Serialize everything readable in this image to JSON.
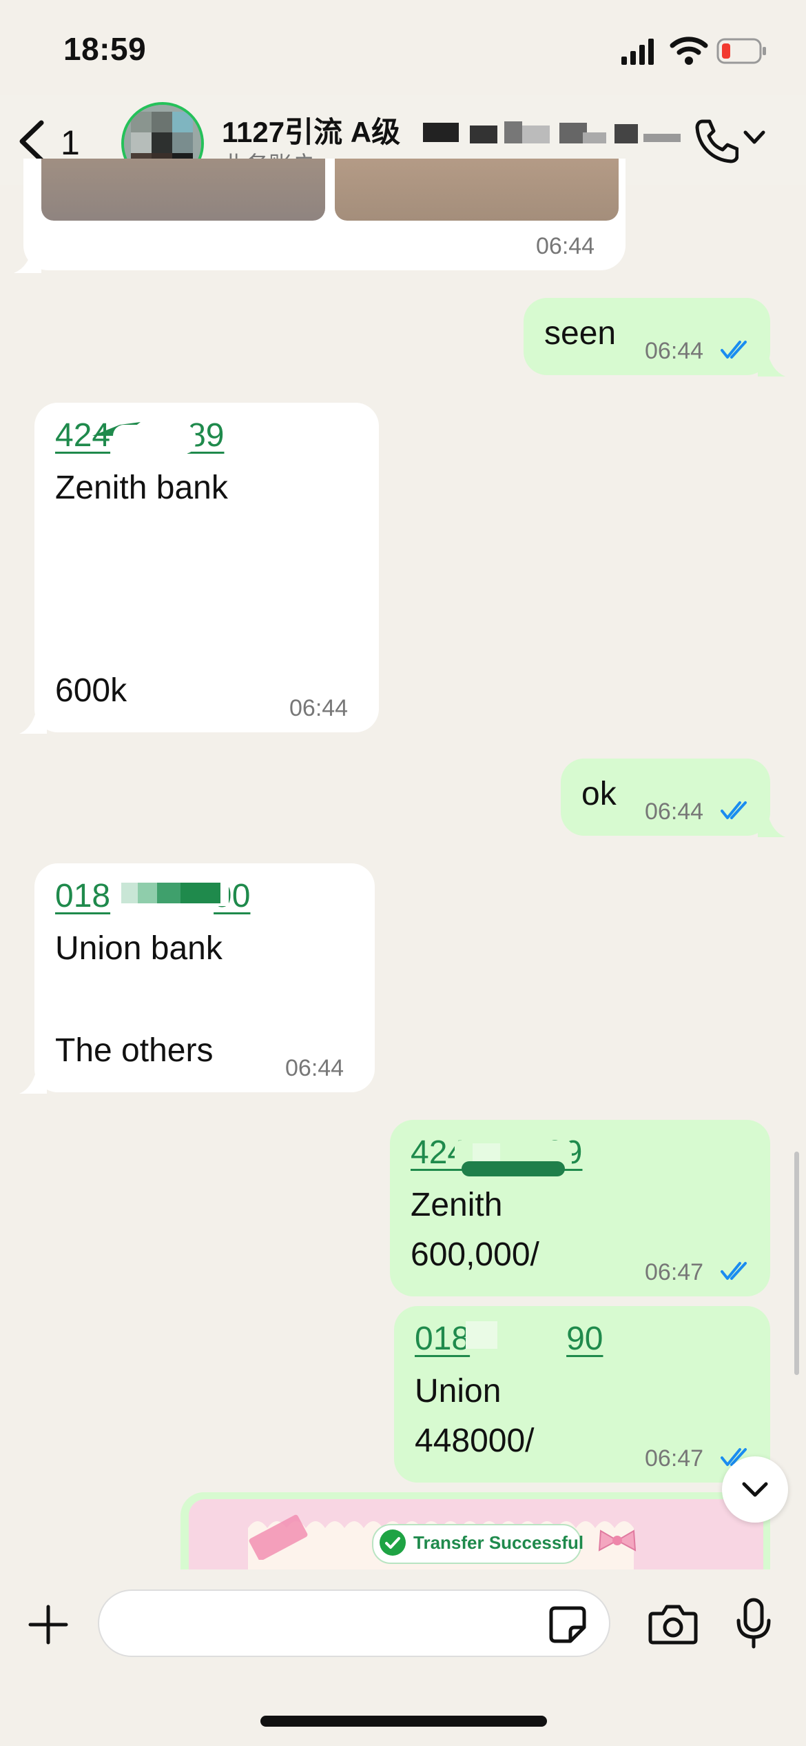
{
  "status_bar": {
    "time": "18:59"
  },
  "header": {
    "back_count": "1",
    "title": "1127引流 A级",
    "subtitle": "业务账户"
  },
  "messages": [
    {
      "time": "06:44"
    },
    {
      "text": "seen",
      "time": "06:44"
    },
    {
      "link": "424",
      "link_end": "89",
      "line1": "Zenith bank",
      "line2": "600k",
      "time": "06:44"
    },
    {
      "text": "ok",
      "time": "06:44"
    },
    {
      "link": "018",
      "link_end": "90",
      "line1": "Union bank",
      "line2": "The others",
      "time": "06:44"
    },
    {
      "link": "424",
      "link_end": "89",
      "line1": "Zenith",
      "line2": "600,000/",
      "time": "06:47"
    },
    {
      "link": "018",
      "link_end": "90",
      "line1": "Union",
      "line2": "448000/",
      "time": "06:47"
    },
    {
      "sticker_text": "Transfer Successful"
    }
  ],
  "composer": {
    "placeholder": ""
  },
  "icons": [
    "cellular-signal-icon",
    "wifi-icon",
    "battery-icon",
    "back-chevron-icon",
    "phone-icon",
    "chevron-down-icon",
    "double-check-icon",
    "plus-icon",
    "sticker-icon",
    "camera-icon",
    "microphone-icon",
    "scroll-down-icon"
  ],
  "colors": {
    "outgoing_bubble": "#d7fad0",
    "incoming_bubble": "#ffffff",
    "link": "#1f8a4c",
    "read_ticks": "#1a8cf0",
    "battery_low": "#f23a30"
  }
}
